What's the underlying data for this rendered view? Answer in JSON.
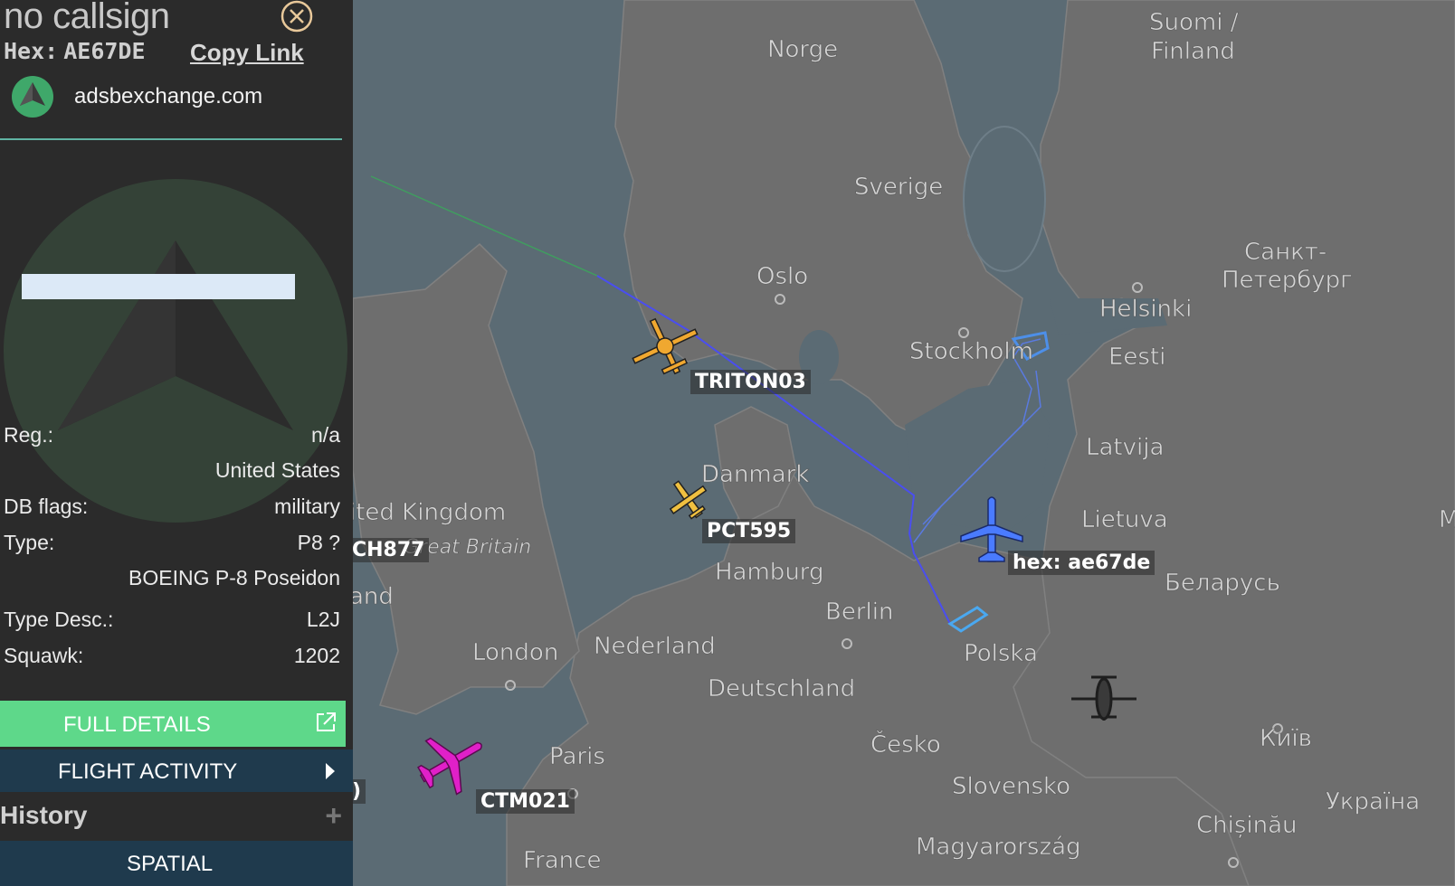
{
  "sidebar": {
    "callsign": "no callsign",
    "hex_label": "Hex:",
    "hex_value": "AE67DE",
    "copy_link": "Copy Link",
    "site": "adsbexchange.com",
    "details": {
      "reg_label": "Reg.:",
      "reg_value": "n/a",
      "country": "United States",
      "dbflags_label": "DB flags:",
      "dbflags_value": "military",
      "type_label": "Type:",
      "type_value": "P8 ?",
      "type_name": "BOEING P-8 Poseidon",
      "typedesc_label": "Type Desc.:",
      "typedesc_value": "L2J",
      "squawk_label": "Squawk:",
      "squawk_value": "1202"
    },
    "buttons": {
      "full_details": "FULL DETAILS",
      "flight_activity": "FLIGHT ACTIVITY",
      "history": "History",
      "spatial": "SPATIAL"
    }
  },
  "map": {
    "places": {
      "norge": "Norge",
      "sverige": "Sverige",
      "suomi1": "Suomi /",
      "suomi2": "Finland",
      "oslo": "Oslo",
      "stockholm": "Stockholm",
      "helsinki": "Helsinki",
      "spb1": "Санкт-",
      "spb2": "Петербург",
      "eesti": "Eesti",
      "latvija": "Latvija",
      "lietuva": "Lietuva",
      "danmark": "Danmark",
      "uk": "ited Kingdom",
      "gb": "Great Britain",
      "land": "and",
      "hamburg": "Hamburg",
      "berlin": "Berlin",
      "belarus": "Беларусь",
      "nederland": "Nederland",
      "london": "London",
      "polska": "Polska",
      "deutschland": "Deutschland",
      "cesko": "Česko",
      "kyiv": "Київ",
      "paris": "Paris",
      "slovensko": "Slovensko",
      "ukraina": "Україна",
      "chisinau": "Chișinău",
      "magyar": "Magyarország",
      "france": "France",
      "m": "M"
    },
    "aircraft": {
      "triton": "TRITON03",
      "pct": "PCT595",
      "ch": "CH877",
      "selected": "hex: ae67de",
      "ctm": "CTM021",
      "edge": ")"
    },
    "colors": {
      "water": "#5b6b74",
      "land": "#6c6c6c",
      "track": "#4a4ef0",
      "selected_plane": "#4a7bff",
      "orange_plane": "#f0a830",
      "magenta_plane": "#e020c8"
    }
  }
}
